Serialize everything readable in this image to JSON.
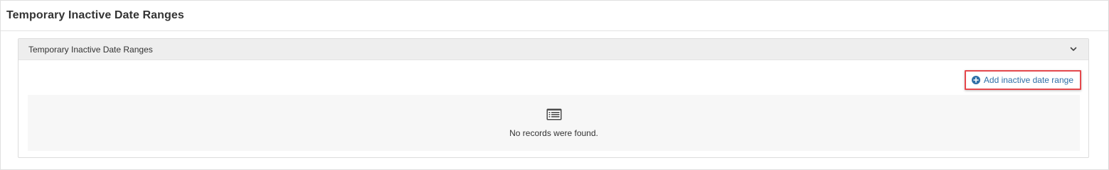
{
  "page": {
    "title": "Temporary Inactive Date Ranges"
  },
  "panel": {
    "heading": "Temporary Inactive Date Ranges",
    "collapse_icon": "chevron-down-icon"
  },
  "toolbar": {
    "add_label": "Add inactive date range",
    "add_icon": "plus-circle-icon",
    "highlight_color": "#e5484d",
    "link_color": "#2f6fa7"
  },
  "empty_state": {
    "icon": "list-icon",
    "message": "No records were found."
  }
}
